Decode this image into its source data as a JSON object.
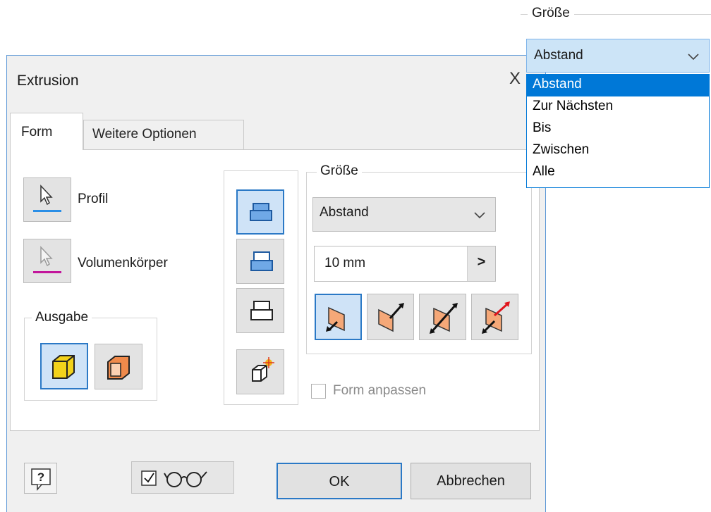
{
  "dialog": {
    "title": "Extrusion",
    "close_glyph": "X"
  },
  "tabs": [
    {
      "label": "Form",
      "active": true
    },
    {
      "label": "Weitere Optionen",
      "active": false
    }
  ],
  "selectors": {
    "profile_label": "Profil",
    "solid_label": "Volumenkörper"
  },
  "output": {
    "title": "Ausgabe",
    "icons": [
      "solid-output-icon",
      "surface-output-icon"
    ]
  },
  "extents_group": {
    "title": "Größe",
    "type_value": "Abstand",
    "distance_value": "10 mm",
    "distance_menu_glyph": ">",
    "direction_icons": [
      "direction-default-icon",
      "direction-flipped-icon",
      "direction-symmetric-icon",
      "direction-asymmetric-icon"
    ]
  },
  "match_shape": {
    "label": "Form anpassen",
    "checked": false
  },
  "buttons": {
    "ok": "OK",
    "cancel": "Abbrechen"
  },
  "popout": {
    "title": "Größe",
    "selected": "Abstand",
    "options": [
      "Abstand",
      "Zur Nächsten",
      "Bis",
      "Zwischen",
      "Alle"
    ],
    "highlighted_index": 0
  },
  "colors": {
    "accent": "#0078d7",
    "selection_fill": "#cfe3f7",
    "profile_underline": "#2a8ee6",
    "solid_underline": "#c2169b",
    "solid_face": "#f2d21b",
    "surface_face": "#f08a4b"
  }
}
